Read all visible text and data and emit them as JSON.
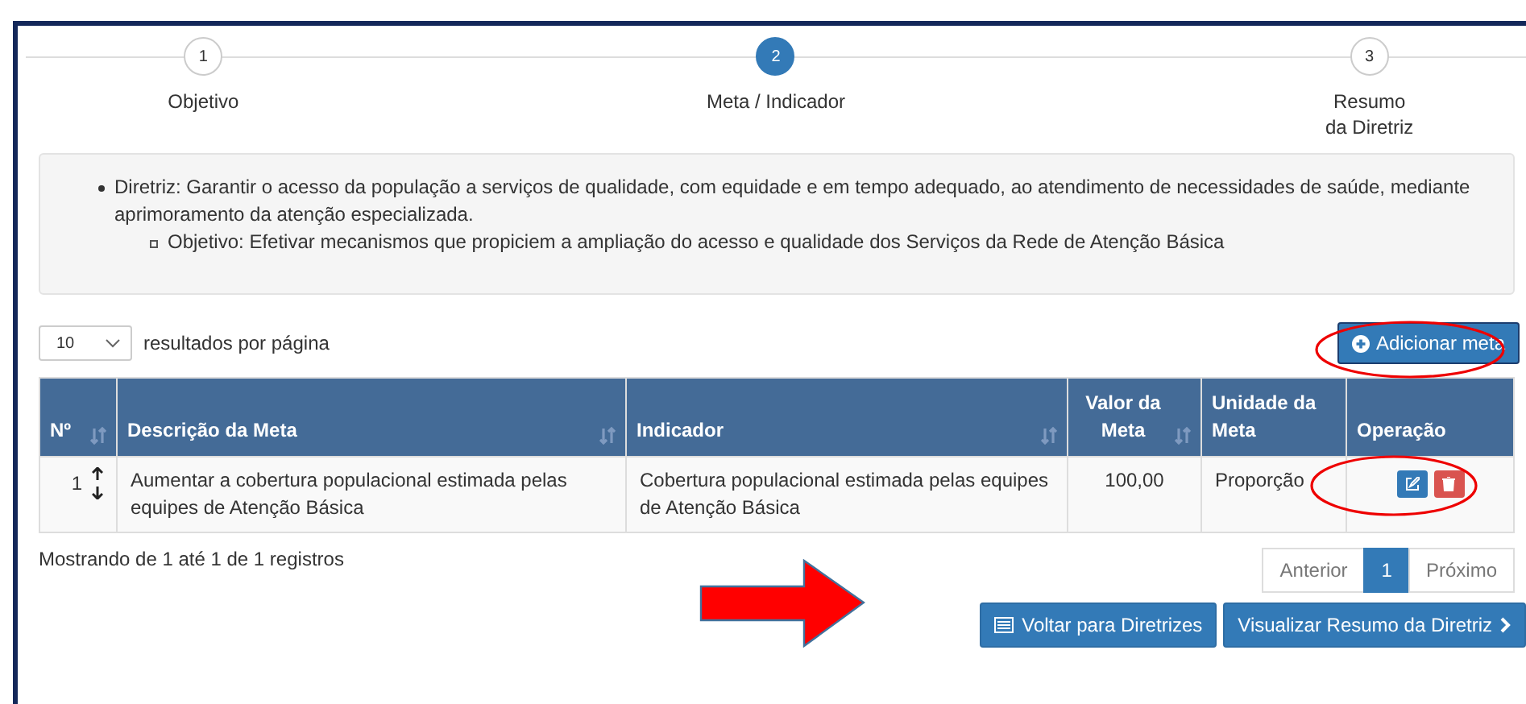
{
  "steps": [
    {
      "number": "1",
      "label": "Objetivo",
      "selected": false
    },
    {
      "number": "2",
      "label": "Meta / Indicador",
      "selected": true
    },
    {
      "number": "3",
      "label": "Resumo da Diretriz",
      "selected": false
    }
  ],
  "info": {
    "diretriz": "Diretriz: Garantir o acesso da população a serviços de qualidade, com equidade e em tempo adequado, ao atendimento de necessidades de saúde, mediante aprimoramento da atenção especializada.",
    "objetivo": "Objetivo: Efetivar mecanismos que propiciem a ampliação do acesso e qualidade dos Serviços da Rede de Atenção Básica"
  },
  "page_size": {
    "value": "10",
    "label": "resultados por página"
  },
  "add_button": "Adicionar meta",
  "table": {
    "columns": [
      {
        "label": "Nº",
        "sortable": true
      },
      {
        "label": "Descrição da Meta",
        "sortable": true
      },
      {
        "label": "Indicador",
        "sortable": true
      },
      {
        "label": "Valor da Meta",
        "sortable": true
      },
      {
        "label": "Unidade da Meta",
        "sortable": false
      },
      {
        "label": "Operação",
        "sortable": false
      }
    ],
    "rows": [
      {
        "number": "1",
        "descricao": "Aumentar a cobertura populacional estimada pelas equipes de Atenção Básica",
        "indicador": "Cobertura populacional estimada pelas equipes de Atenção Básica",
        "valor": "100,00",
        "unidade": "Proporção"
      }
    ]
  },
  "summary": "Mostrando de 1 até 1 de 1 registros",
  "pagination": [
    {
      "label": "Anterior",
      "selected": false
    },
    {
      "label": "1",
      "selected": true
    },
    {
      "label": "Próximo",
      "selected": false
    }
  ],
  "buttons": [
    {
      "label": "Voltar para Diretrizes",
      "kind": "back"
    },
    {
      "label": "Visualizar Resumo da Diretriz",
      "kind": "next"
    }
  ]
}
